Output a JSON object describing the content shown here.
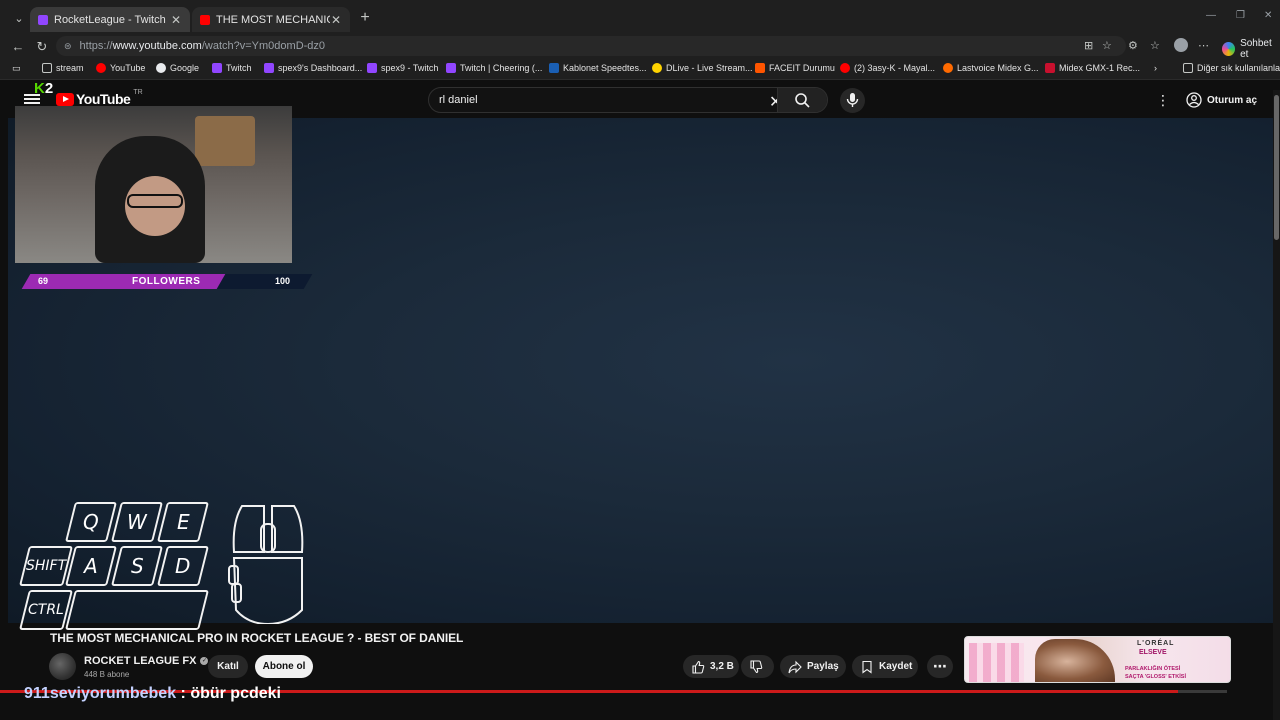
{
  "browser": {
    "tabs": [
      {
        "title": "RocketLeague - Twitch",
        "favicon_color": "#9146ff",
        "active": true
      },
      {
        "title": "THE MOST MECHANICAL PRO IN R",
        "favicon_color": "#ff0000",
        "active": false
      }
    ],
    "url": {
      "scheme": "https://",
      "host": "www.youtube.com",
      "path": "/watch?v=Ym0domD-dz0"
    },
    "copilot_label": "Sohbet et",
    "bookmarks": [
      {
        "label": "stream",
        "icon_color": "#c4c7c5"
      },
      {
        "label": "YouTube",
        "icon_color": "#ff0000"
      },
      {
        "label": "Google",
        "icon_color": "#e8eaed"
      },
      {
        "label": "Twitch",
        "icon_color": "#9146ff"
      },
      {
        "label": "spex9's Dashboard...",
        "icon_color": "#9146ff"
      },
      {
        "label": "spex9 - Twitch",
        "icon_color": "#9146ff"
      },
      {
        "label": "Twitch | Cheering (...",
        "icon_color": "#9146ff"
      },
      {
        "label": "Kablonet Speedtes...",
        "icon_color": "#1a5fb4"
      },
      {
        "label": "DLive - Live Stream...",
        "icon_color": "#ffd300"
      },
      {
        "label": "FACEIT Durumu",
        "icon_color": "#ff5500"
      },
      {
        "label": "(2) 3asy-K - Mayal...",
        "icon_color": "#ff0000"
      },
      {
        "label": "Lastvoice Midex G...",
        "icon_color": "#ff6a00"
      },
      {
        "label": "Midex GMX-1 Rec...",
        "icon_color": "#c8102e"
      }
    ],
    "other_bookmarks": "Diğer sık kullanılanlar"
  },
  "youtube": {
    "logo_text": "YouTube",
    "country_code": "TR",
    "search_query": "rl daniel",
    "signin_label": "Oturum aç",
    "video_title": "THE MOST MECHANICAL PRO IN ROCKET LEAGUE ? - BEST OF DANIEL",
    "channel_name": "ROCKET LEAGUE FX",
    "subscribers": "448 B abone",
    "join_label": "Katıl",
    "subscribe_label": "Abone ol",
    "likes": "3,2 B",
    "share_label": "Paylaş",
    "save_label": "Kaydet",
    "progress": 0.96
  },
  "ad": {
    "brand": "L'ORÉAL",
    "product": "ELSEVE",
    "copy_line1": "PARLAKLIĞIN ÖTESİ",
    "copy_line2": "SAÇTA 'GLOSS' ETKİSİ"
  },
  "overlay": {
    "logo_text": "K2",
    "followers_current": "69",
    "followers_goal": "100",
    "followers_label": "FOLLOWERS",
    "followers_progress": 0.69,
    "keys": {
      "q": "Q",
      "w": "W",
      "e": "E",
      "shift": "SHIFT",
      "a": "A",
      "s": "S",
      "d": "D",
      "ctrl": "CTRL"
    },
    "chat_user": "911seviyorumbebek",
    "chat_sep": " : ",
    "chat_message": "öbür pcdeki"
  }
}
